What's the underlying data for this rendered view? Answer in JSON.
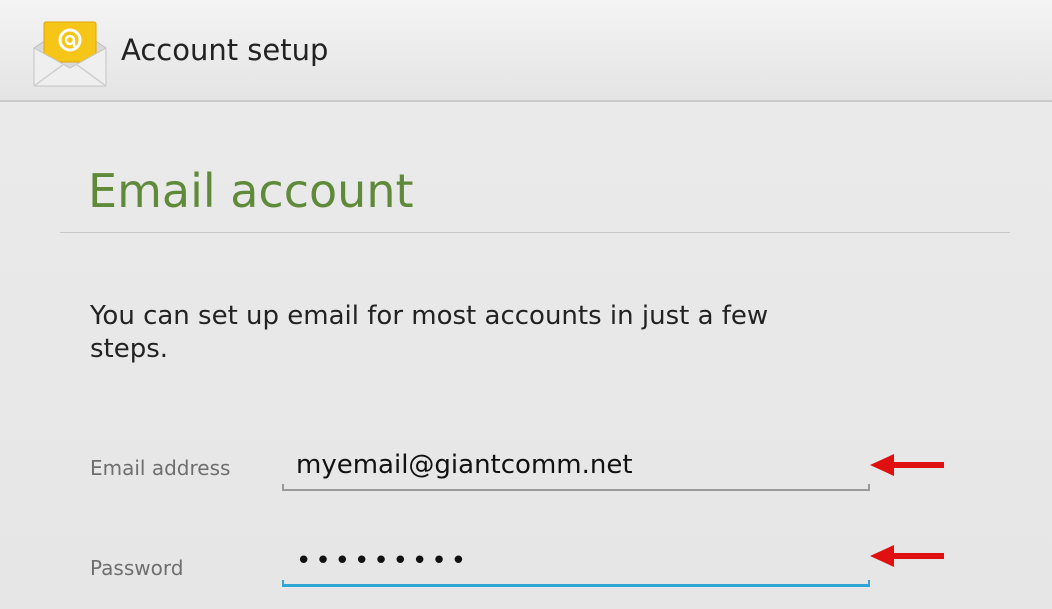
{
  "action_bar": {
    "title": "Account setup",
    "icon": "email-app-icon"
  },
  "main": {
    "heading": "Email account",
    "intro": "You can set up email for most accounts in just a few steps."
  },
  "form": {
    "email": {
      "label": "Email address",
      "value": "myemail@giantcomm.net"
    },
    "password": {
      "label": "Password",
      "value": "•••••••••"
    }
  },
  "annotations": {
    "arrow_icon": "red-left-arrow-icon",
    "arrow_color": "#e01010"
  },
  "colors": {
    "heading": "#5f8a3a",
    "focus_underline": "#2ea6d6",
    "action_bar": "#ececec"
  }
}
